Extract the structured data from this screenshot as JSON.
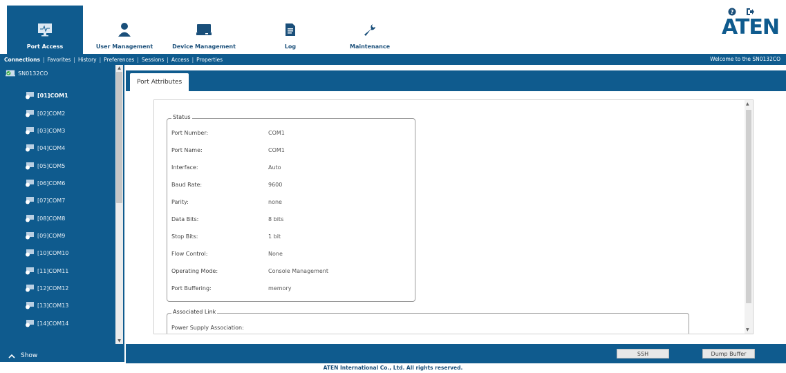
{
  "header": {
    "nav": [
      {
        "label": "Port Access",
        "icon": "monitor-icon"
      },
      {
        "label": "User Management",
        "icon": "user-icon"
      },
      {
        "label": "Device Management",
        "icon": "device-icon"
      },
      {
        "label": "Log",
        "icon": "document-icon"
      },
      {
        "label": "Maintenance",
        "icon": "wrench-icon"
      }
    ],
    "logo": "ATEN",
    "icons": [
      "help-icon",
      "logout-icon"
    ]
  },
  "subnav": {
    "links": [
      "Connections",
      "Favorites",
      "History",
      "Preferences",
      "Sessions",
      "Access",
      "Properties"
    ],
    "welcome": "Welcome to the SN0132CO"
  },
  "sidebar": {
    "root": "SN0132CO",
    "ports": [
      "[01]COM1",
      "[02]COM2",
      "[03]COM3",
      "[04]COM4",
      "[05]COM5",
      "[06]COM6",
      "[07]COM7",
      "[08]COM8",
      "[09]COM9",
      "[10]COM10",
      "[11]COM11",
      "[12]COM12",
      "[13]COM13",
      "[14]COM14"
    ],
    "show_label": "Show"
  },
  "main": {
    "tab": "Port Attributes",
    "status_legend": "Status",
    "status": [
      {
        "label": "Port Number:",
        "value": "COM1"
      },
      {
        "label": "Port Name:",
        "value": "COM1"
      },
      {
        "label": "Interface:",
        "value": "Auto"
      },
      {
        "label": "Baud Rate:",
        "value": "9600"
      },
      {
        "label": "Parity:",
        "value": "none"
      },
      {
        "label": "Data Bits:",
        "value": "8 bits"
      },
      {
        "label": "Stop Bits:",
        "value": "1 bit"
      },
      {
        "label": "Flow Control:",
        "value": "None"
      },
      {
        "label": "Operating Mode:",
        "value": "Console Management"
      },
      {
        "label": "Port Buffering:",
        "value": "memory"
      }
    ],
    "assoc_legend": "Associated Link",
    "assoc_row": "Power Supply Association:"
  },
  "buttons": {
    "ssh": "SSH",
    "dump": "Dump Buffer"
  },
  "footer": "ATEN International Co., Ltd. All rights reserved.",
  "colors": {
    "primary": "#0f5b8e"
  }
}
